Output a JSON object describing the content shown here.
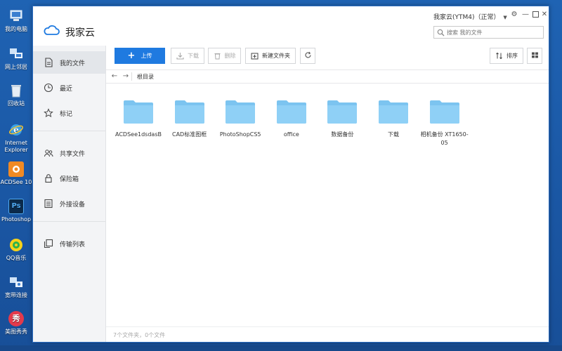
{
  "desktop": {
    "icons": [
      {
        "label": "我的电脑",
        "icon": "computer-icon"
      },
      {
        "label": "网上邻居",
        "icon": "network-icon"
      },
      {
        "label": "回收站",
        "icon": "recycle-bin-icon"
      },
      {
        "label": "Internet Explorer",
        "icon": "ie-icon"
      },
      {
        "label": "ACDSee 10",
        "icon": "acdsee-icon"
      },
      {
        "label": "Photoshop",
        "icon": "photoshop-icon"
      },
      {
        "label": "QQ音乐",
        "icon": "qq-music-icon"
      },
      {
        "label": "宽带连接",
        "icon": "broadband-icon"
      },
      {
        "label": "美图秀秀",
        "icon": "meitu-icon"
      }
    ]
  },
  "app": {
    "name": "我家云",
    "account": "我家云(YTM4)（正常）",
    "window_controls": [
      "settings-icon",
      "minimize-icon",
      "maximize-icon",
      "close-icon"
    ],
    "search_placeholder": "搜索 我的文件"
  },
  "sidebar": {
    "items": [
      {
        "label": "我的文件",
        "icon": "document-icon",
        "active": true
      },
      {
        "label": "最近",
        "icon": "clock-icon"
      },
      {
        "label": "标记",
        "icon": "star-icon"
      },
      {
        "label": "共享文件",
        "icon": "users-icon"
      },
      {
        "label": "保险箱",
        "icon": "lock-icon"
      },
      {
        "label": "外接设备",
        "icon": "device-list-icon"
      },
      {
        "label": "传输列表",
        "icon": "transfer-icon"
      }
    ]
  },
  "toolbar": {
    "upload": "上传",
    "download": "下载",
    "delete": "删除",
    "new_folder": "新建文件夹",
    "sort": "排序"
  },
  "breadcrumb": {
    "path": "根目录"
  },
  "files": [
    {
      "name": "ACDSee1dsdasB",
      "type": "folder"
    },
    {
      "name": "CAD标准图框",
      "type": "folder"
    },
    {
      "name": "PhotoShopCS5",
      "type": "folder"
    },
    {
      "name": "office",
      "type": "folder"
    },
    {
      "name": "数据备份",
      "type": "folder"
    },
    {
      "name": "下载",
      "type": "folder"
    },
    {
      "name": "相机备份 XT1650-05",
      "type": "folder"
    }
  ],
  "status": {
    "summary": "7个文件夹，0个文件"
  },
  "colors": {
    "accent": "#1f7ae0",
    "folder": "#7cc4f0",
    "desktop": "#1b5ba8"
  }
}
